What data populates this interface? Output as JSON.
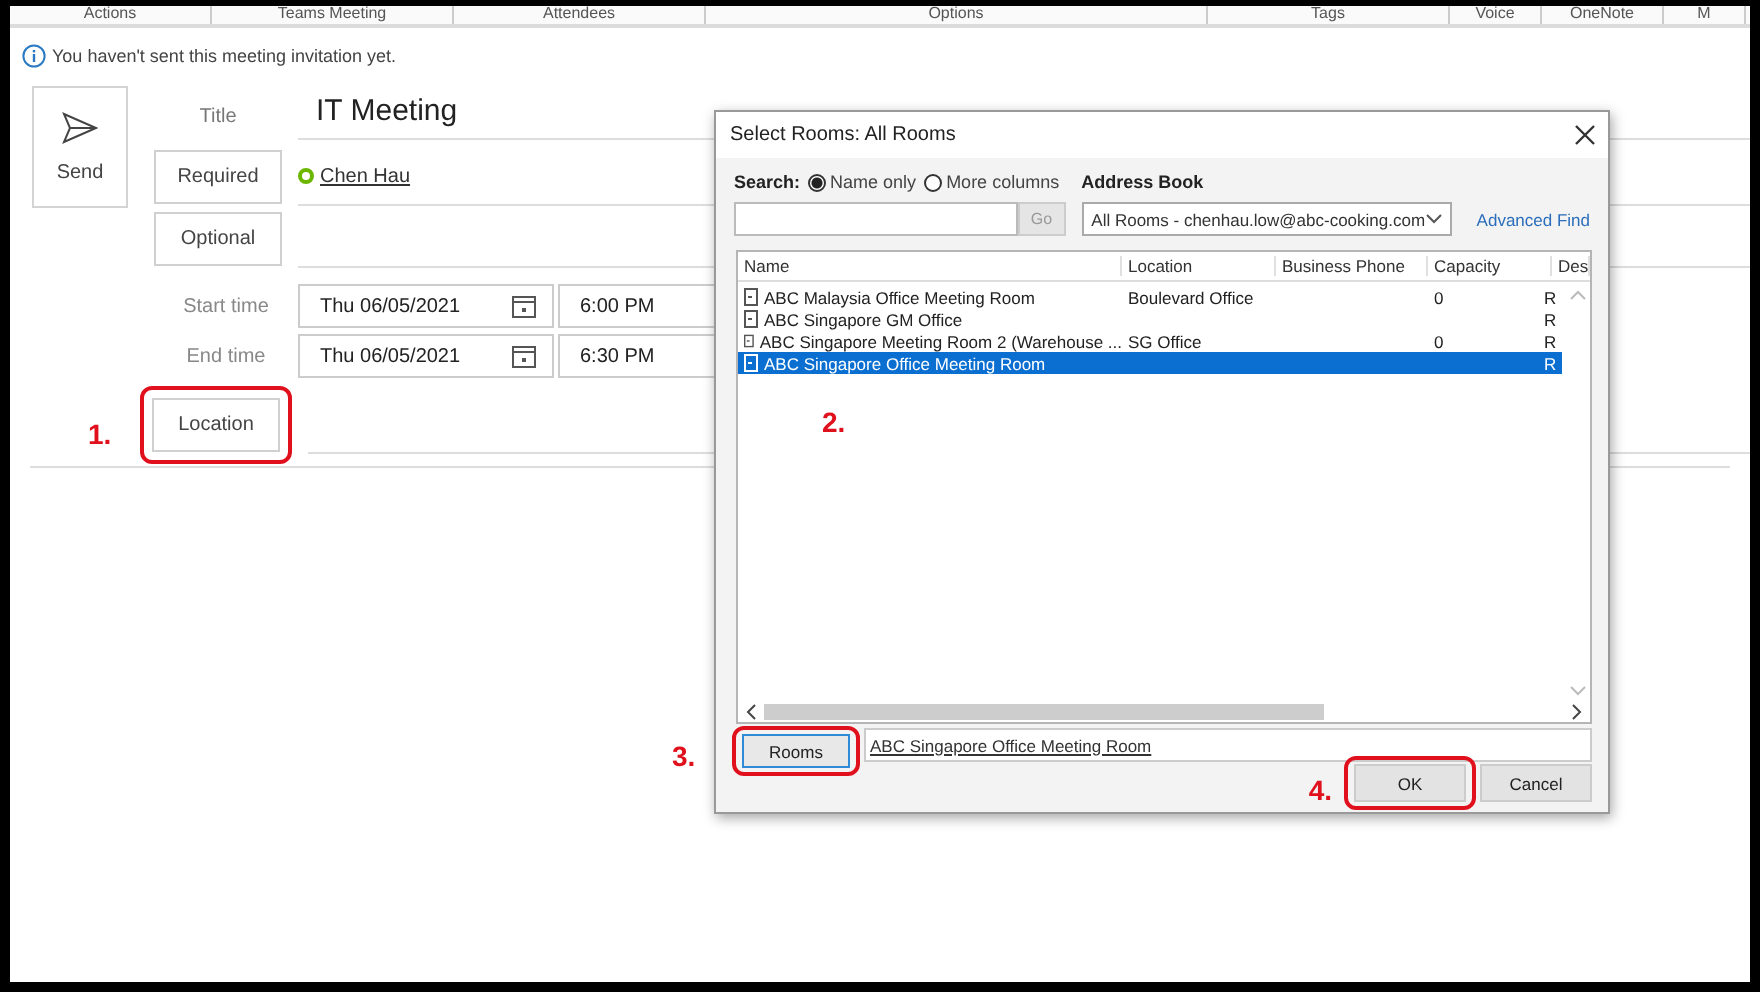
{
  "ribbon_groups": [
    "Actions",
    "Teams Meeting",
    "Attendees",
    "Options",
    "Tags",
    "Voice",
    "OneNote",
    "M"
  ],
  "info_bar": {
    "text": "You haven't sent this meeting invitation yet."
  },
  "send_button": "Send",
  "form": {
    "title_label": "Title",
    "title_value": "IT Meeting",
    "required_button": "Required",
    "attendees": [
      {
        "name": "Chen Hau"
      }
    ],
    "optional_button": "Optional",
    "times": [
      {
        "label": "Start time",
        "date": "Thu 06/05/2021",
        "time": "6:00 PM"
      },
      {
        "label": "End time",
        "date": "Thu 06/05/2021",
        "time": "6:30 PM"
      }
    ],
    "location_button": "Location"
  },
  "dialog": {
    "title": "Select Rooms: All Rooms",
    "search_label": "Search:",
    "search_options": [
      {
        "label": "Name only",
        "selected": true
      },
      {
        "label": "More columns",
        "selected": false
      }
    ],
    "address_book_label": "Address Book",
    "go_button": "Go",
    "address_book": "All Rooms - chenhau.low@abc-cooking.com",
    "advanced_find": "Advanced Find",
    "columns": [
      "Name",
      "Location",
      "Business Phone",
      "Capacity",
      "Des"
    ],
    "rows": [
      {
        "name": "ABC Malaysia Office Meeting Room",
        "location": "Boulevard Office",
        "capacity": "0",
        "column_5": "R",
        "selected": false
      },
      {
        "name": "ABC Singapore GM Office",
        "column_5": "R",
        "selected": false
      },
      {
        "name": "ABC Singapore Meeting Room 2 (Warehouse ...",
        "location": "SG Office",
        "capacity": "0",
        "column_5": "R",
        "selected": false
      },
      {
        "name": "ABC Singapore Office Meeting Room",
        "column_5": "R",
        "selected": true
      }
    ],
    "rooms_button": "Rooms",
    "rooms_value": "ABC Singapore Office Meeting Room",
    "ok_button": "OK",
    "cancel_button": "Cancel"
  },
  "steps": [
    "1.",
    "2.",
    "3.",
    "4."
  ]
}
